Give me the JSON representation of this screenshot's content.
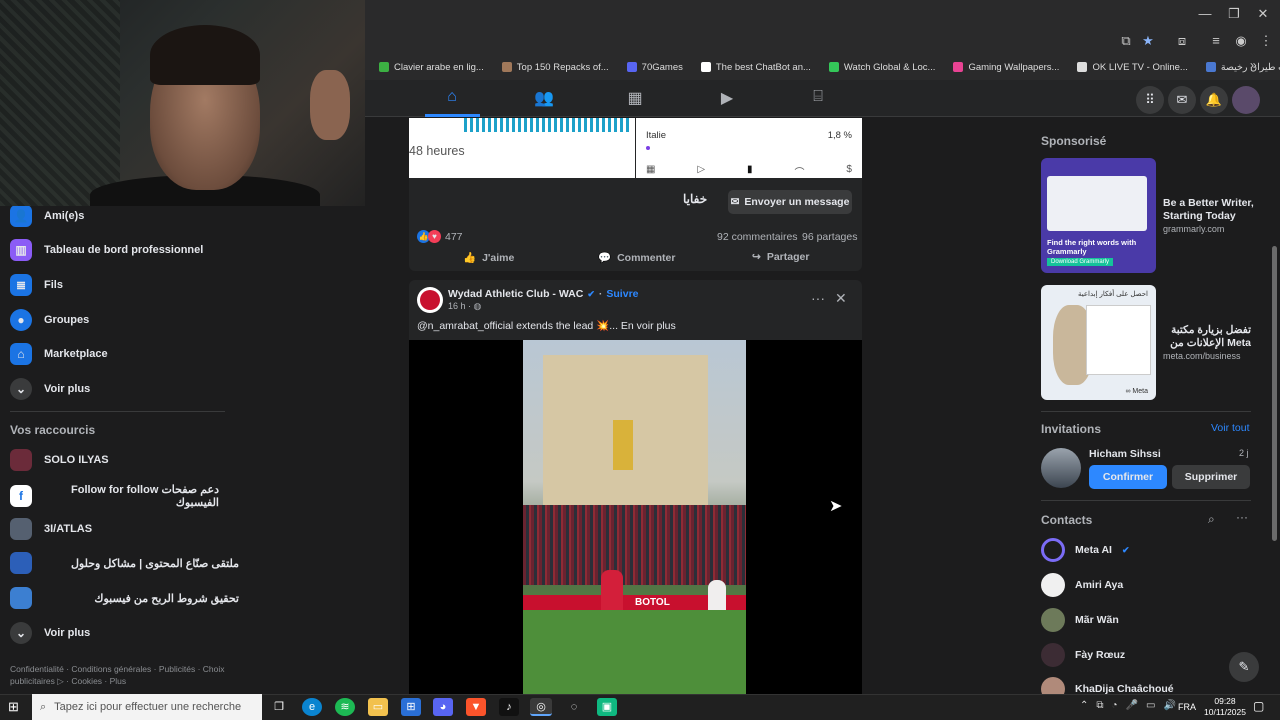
{
  "bookmarks": [
    "Clavier arabe en lig...",
    "Top 150 Repacks of...",
    "70Games",
    "The best ChatBot an...",
    "Watch Global & Loc...",
    "Gaming Wallpapers...",
    "OK LIVE TV - Online...",
    "رحلات طيران رخيصة..."
  ],
  "left_nav": {
    "items": [
      "Ami(e)s",
      "Tableau de bord professionnel",
      "Fils",
      "Groupes",
      "Marketplace",
      "Voir plus"
    ],
    "shortcuts_title": "Vos raccourcis",
    "shortcuts": [
      "SOLO ILYAS",
      "Follow for follow دعم صفحات الفيسبوك",
      "3I/ATLAS",
      "ملتقى صنّاع المحتوى | مشاكل وحلول",
      "تحقيق شروط الربح من فيسبوك",
      "Voir plus"
    ],
    "footer": "Confidentialité · Conditions générales · Publicités · Choix publicitaires ▷ · Cookies · Plus"
  },
  "post1": {
    "hours_label": "48 heures",
    "country": "Italie",
    "country_pct": "1,8 %",
    "page_name": "خفايا",
    "message_btn": "Envoyer un message",
    "reactions": "477",
    "comments": "92 commentaires",
    "shares": "96 partages",
    "like_label": "J'aime",
    "comment_label": "Commenter",
    "share_label": "Partager"
  },
  "post2": {
    "author": "Wydad Athletic Club - WAC",
    "follow": "Suivre",
    "time": "16 h · ",
    "text": "@n_amrabat_official extends the lead 💥... En voir plus",
    "banner": "BOTOL"
  },
  "right": {
    "sponsored_title": "Sponsorisé",
    "ads": [
      {
        "title": "Be a Better Writer, Starting Today",
        "domain": "grammarly.com",
        "img_text": "Find the right words with Grammarly",
        "img_btn": "Download Grammarly"
      },
      {
        "title": "تفضل بزيارة مكتبة الإعلانات من Meta",
        "domain": "meta.com/business",
        "img_text": "احصل على أفكار إبداعية",
        "img_brand": "∞ Meta"
      }
    ],
    "invitations_title": "Invitations",
    "see_all": "Voir tout",
    "invite_name": "Hicham Sihssi",
    "invite_time": "2 j",
    "confirm": "Confirmer",
    "delete": "Supprimer",
    "contacts_title": "Contacts",
    "contacts": [
      "Meta AI",
      "Amiri Aya",
      "Mãr Wãn",
      "Fày Rœuz",
      "KhaDija Chaâchoué"
    ]
  },
  "taskbar": {
    "search_placeholder": "Tapez ici pour effectuer une recherche",
    "lang": "FRA",
    "time": "09:28",
    "date": "10/11/2025"
  },
  "colors": {
    "accent": "#2d88ff",
    "bg": "#1c1c1d",
    "card": "#242526"
  }
}
